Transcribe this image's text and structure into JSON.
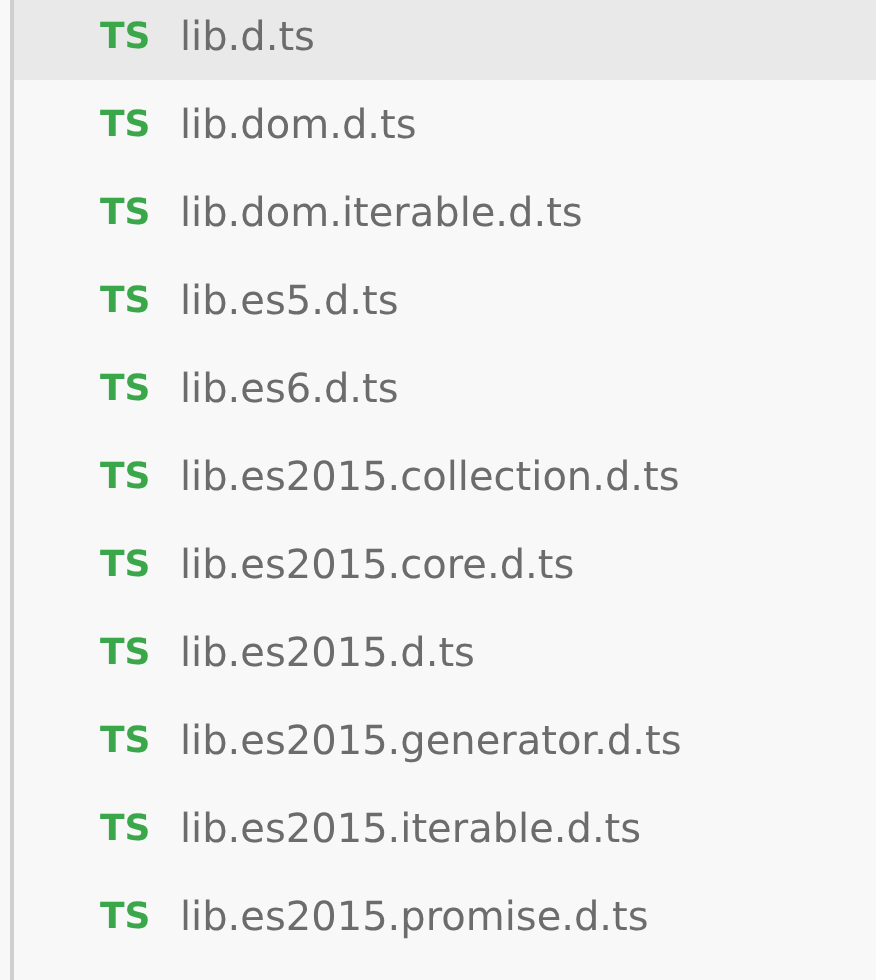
{
  "files": [
    {
      "badge": "TS",
      "name": "lib.d.ts",
      "selected": true
    },
    {
      "badge": "TS",
      "name": "lib.dom.d.ts",
      "selected": false
    },
    {
      "badge": "TS",
      "name": "lib.dom.iterable.d.ts",
      "selected": false
    },
    {
      "badge": "TS",
      "name": "lib.es5.d.ts",
      "selected": false
    },
    {
      "badge": "TS",
      "name": "lib.es6.d.ts",
      "selected": false
    },
    {
      "badge": "TS",
      "name": "lib.es2015.collection.d.ts",
      "selected": false
    },
    {
      "badge": "TS",
      "name": "lib.es2015.core.d.ts",
      "selected": false
    },
    {
      "badge": "TS",
      "name": "lib.es2015.d.ts",
      "selected": false
    },
    {
      "badge": "TS",
      "name": "lib.es2015.generator.d.ts",
      "selected": false
    },
    {
      "badge": "TS",
      "name": "lib.es2015.iterable.d.ts",
      "selected": false
    },
    {
      "badge": "TS",
      "name": "lib.es2015.promise.d.ts",
      "selected": false
    }
  ]
}
